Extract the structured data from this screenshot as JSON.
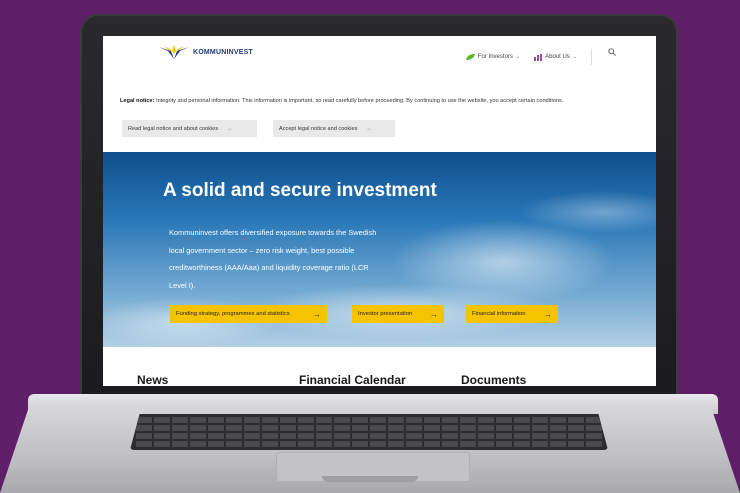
{
  "header": {
    "logo_text": "KOMMUNINVEST",
    "nav": [
      {
        "label": "For Investors",
        "icon": "leaf-icon"
      },
      {
        "label": "About Us",
        "icon": "chart-icon"
      }
    ]
  },
  "legal": {
    "title": "Legal notice:",
    "text": "Integrity and personal information. This information is important, so read carefully before proceeding. By continuing to use the website, you accept certain conditions.",
    "buttons": [
      "Read legal notice and about cookies",
      "Accept legal notice and cookies"
    ]
  },
  "hero": {
    "title": "A solid and secure investment",
    "text": "Kommuninvest offers diversified exposure towards the Swedish local government sector – zero risk weight, best possible creditworthiness (AAA/Aaa) and liquidity coverage ratio (LCR Level I).",
    "buttons": [
      "Funding strategy, programmes and statistics",
      "Investor presentation",
      "Financial information"
    ]
  },
  "sections": [
    "News",
    "Financial Calendar",
    "Documents"
  ],
  "colors": {
    "background": "#5e1f68",
    "accent": "#f6c300",
    "brand": "#1e3c78"
  }
}
